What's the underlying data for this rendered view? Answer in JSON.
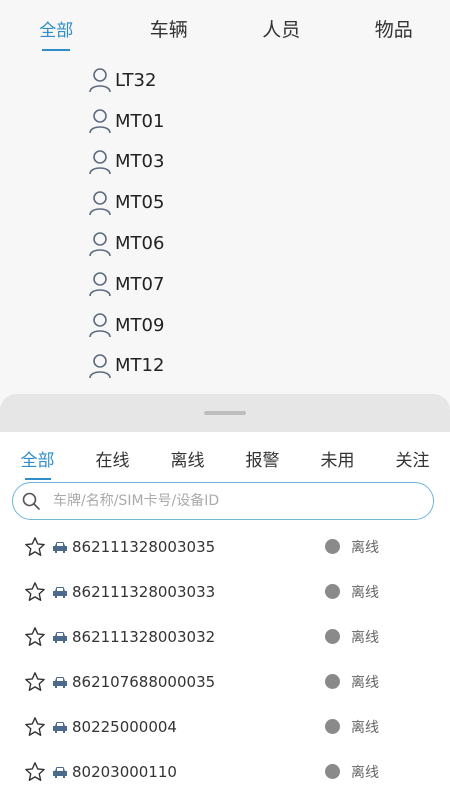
{
  "top_tabs": [
    {
      "label": "全部",
      "active": true
    },
    {
      "label": "车辆",
      "active": false
    },
    {
      "label": "人员",
      "active": false
    },
    {
      "label": "物品",
      "active": false
    }
  ],
  "tree_items": [
    "LT32",
    "MT01",
    "MT03",
    "MT05",
    "MT06",
    "MT07",
    "MT09",
    "MT12"
  ],
  "filter_tabs": [
    {
      "label": "全部",
      "active": true
    },
    {
      "label": "在线",
      "active": false
    },
    {
      "label": "离线",
      "active": false
    },
    {
      "label": "报警",
      "active": false
    },
    {
      "label": "未用",
      "active": false
    },
    {
      "label": "关注",
      "active": false
    }
  ],
  "search": {
    "placeholder": "车牌/名称/SIM卡号/设备ID",
    "value": ""
  },
  "devices": [
    {
      "id": "862111328003035",
      "status": "离线"
    },
    {
      "id": "862111328003033",
      "status": "离线"
    },
    {
      "id": "862111328003032",
      "status": "离线"
    },
    {
      "id": "862107688000035",
      "status": "离线"
    },
    {
      "id": "80225000004",
      "status": "离线"
    },
    {
      "id": "80203000110",
      "status": "离线"
    }
  ],
  "colors": {
    "accent": "#2f8ec9",
    "offline": "#8a8a8a"
  }
}
